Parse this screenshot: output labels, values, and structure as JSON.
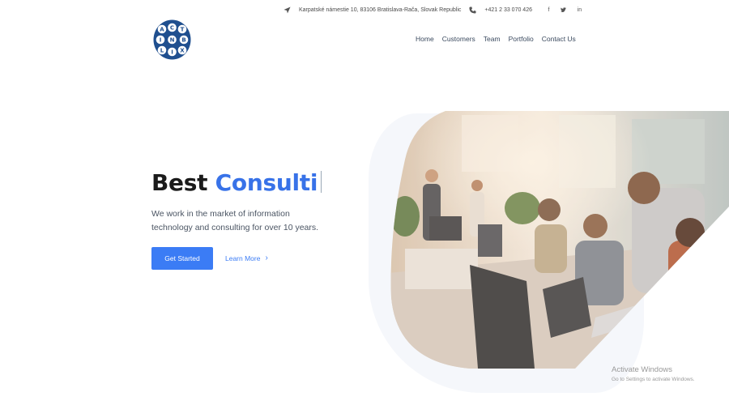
{
  "topbar": {
    "address": "Karpatské námestie 10, 83106 Bratislava-Rača, Slovak Republic",
    "phone": "+421 2 33 070 426",
    "social": {
      "facebook": "f",
      "twitter": "t",
      "linkedin": "in"
    },
    "icons": [
      "location-arrow-icon",
      "phone-icon",
      "facebook-icon",
      "twitter-icon",
      "linkedin-icon"
    ]
  },
  "logo": {
    "letters": [
      "A",
      "C",
      "T",
      "I",
      "N",
      "B",
      "L",
      "I",
      "X"
    ]
  },
  "nav": {
    "items": [
      "Home",
      "Customers",
      "Team",
      "Portfolio",
      "Contact Us"
    ]
  },
  "hero": {
    "title_prefix": "Best",
    "title_highlight": "Consulti",
    "subtitle": "We work in the market of information technology and consulting for over 10 years.",
    "primary_button": "Get Started",
    "secondary_link": "Learn More",
    "secondary_chevron": "›"
  },
  "colors": {
    "accent": "#3b7cf5",
    "highlight_text": "#3872e8",
    "logo_blue": "#1f4f8f"
  },
  "watermark": {
    "line1": "Activate Windows",
    "line2": "Go to Settings to activate Windows."
  }
}
